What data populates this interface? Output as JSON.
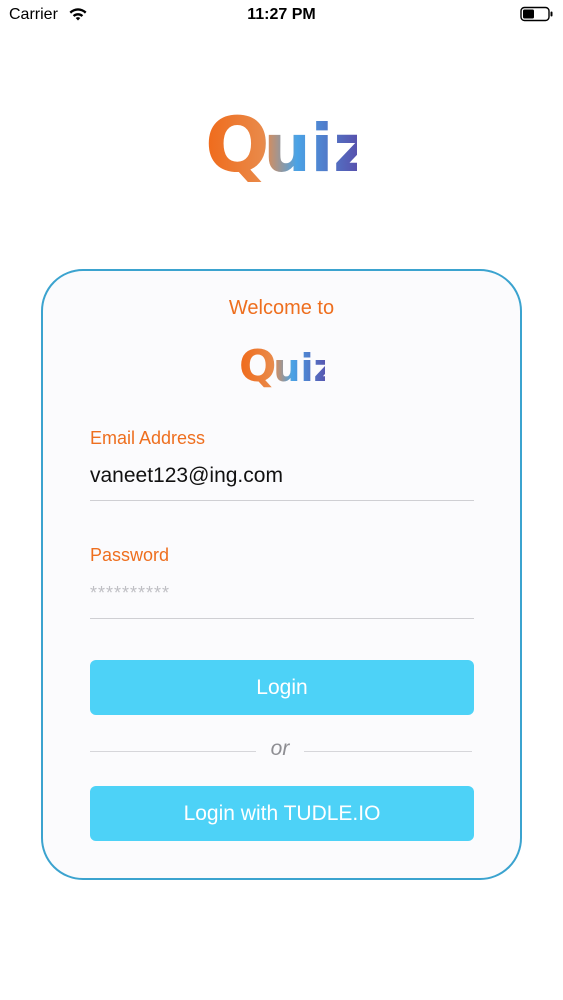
{
  "status_bar": {
    "carrier": "Carrier",
    "time": "11:27 PM"
  },
  "logo": {
    "text_q": "Q",
    "text_rest": "uiz",
    "color_orange": "#f06a1a",
    "color_blue": "#4aa3e6",
    "color_purple": "#5b3fa0"
  },
  "card": {
    "welcome": "Welcome to",
    "email_label": "Email Address",
    "email_value": "vaneet123@ing.com",
    "password_label": "Password",
    "password_placeholder": "**********",
    "login_label": "Login",
    "or_label": "or",
    "tudle_label": "Login with TUDLE.IO"
  },
  "colors": {
    "accent_orange": "#ee6f1f",
    "button_blue": "#4dd2f7",
    "card_border": "#3ba3cf"
  }
}
